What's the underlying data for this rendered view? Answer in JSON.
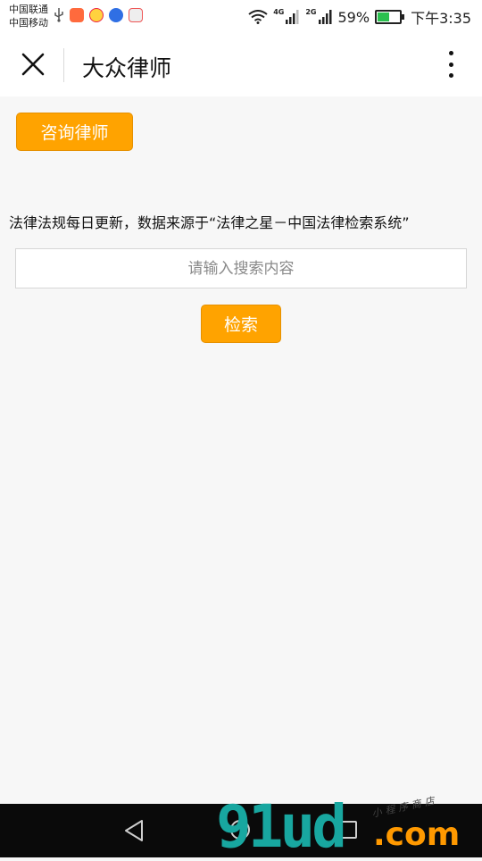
{
  "status_bar": {
    "carrier_1": "中国联通",
    "carrier_2": "中国移动",
    "net_1": "4G",
    "net_2": "2G",
    "battery": "59%",
    "battery_level": 0.59,
    "time": "下午3:35"
  },
  "navbar": {
    "title": "大众律师",
    "close_icon": "close-icon",
    "more_icon": "more-vertical-icon"
  },
  "page": {
    "consult_button": "咨询律师",
    "notice": "法律法规每日更新，数据来源于“法律之星－中国法律检索系统”",
    "search_placeholder": "请输入搜索内容",
    "search_value": "",
    "search_button": "检索"
  },
  "system_nav": {
    "back_icon": "back-triangle-icon",
    "home_icon": "home-circle-icon",
    "recent_icon": "recent-square-icon"
  },
  "watermark": {
    "main": "91ud",
    "domain": ".com",
    "tagline": "小程序商店"
  },
  "colors": {
    "accent": "#ffa300",
    "background": "#f7f7f7",
    "watermark_teal": "#18a7a0",
    "watermark_orange": "#ff9900"
  }
}
